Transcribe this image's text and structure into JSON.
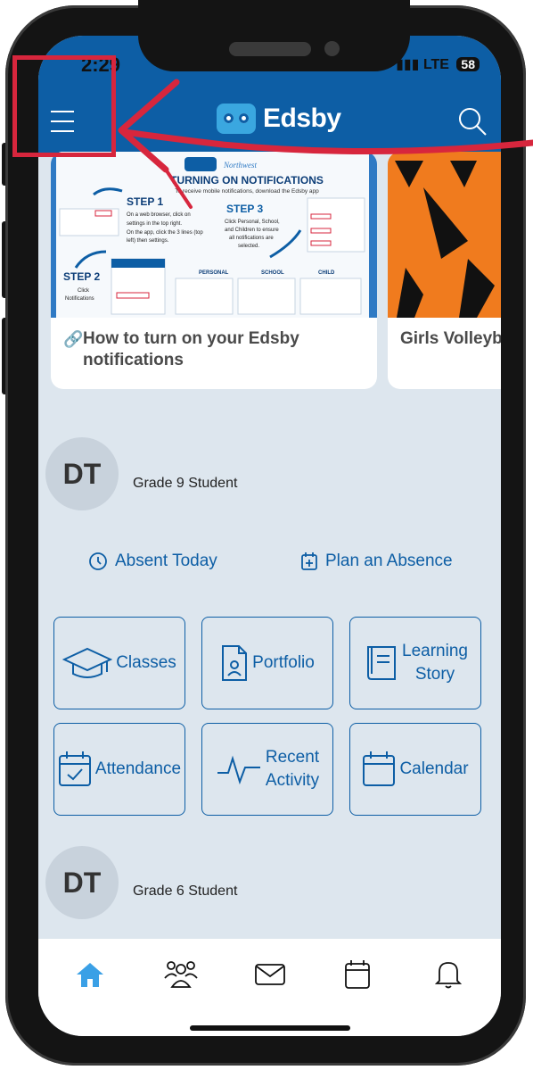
{
  "status": {
    "time": "2:29",
    "network": "LTE",
    "battery": "58"
  },
  "app": {
    "name": "Edsby"
  },
  "cards": [
    {
      "title_line1": "How to turn on your Edsby",
      "title_line2": "notifications",
      "poster": {
        "heading": "TURNING ON NOTIFICATIONS",
        "subheading": "To receive mobile notifications, download the Edsby app",
        "brand": "Northwest",
        "step1": "STEP 1",
        "step1_text": "On a web browser, click on settings in the top right. On the app, click the 3 lines (top left) then settings.",
        "step2": "STEP 2",
        "step2_text": "Click Notifications",
        "step3": "STEP 3",
        "step3_text": "Click Personal, School, and Children to ensure all notifications are selected.",
        "col1": "PERSONAL",
        "col2": "SCHOOL",
        "col3": "CHILD"
      }
    },
    {
      "title_line1": "Girls Volleyb"
    }
  ],
  "students": [
    {
      "initials": "DT",
      "grade": "Grade 9 Student"
    },
    {
      "initials": "DT",
      "grade": "Grade 6 Student"
    }
  ],
  "actions": {
    "absent": "Absent Today",
    "plan": "Plan an Absence"
  },
  "tiles": {
    "classes": "Classes",
    "portfolio": "Portfolio",
    "learning_line1": "Learning",
    "learning_line2": "Story",
    "attendance": "Attendance",
    "recent_line1": "Recent",
    "recent_line2": "Activity",
    "calendar": "Calendar"
  },
  "nav_icons": [
    "home-icon",
    "people-icon",
    "mail-icon",
    "calendar-icon",
    "bell-icon"
  ],
  "colors": {
    "brand_blue": "#0d5ea5",
    "background": "#dde6ee",
    "annotation_red": "#d7263d"
  }
}
